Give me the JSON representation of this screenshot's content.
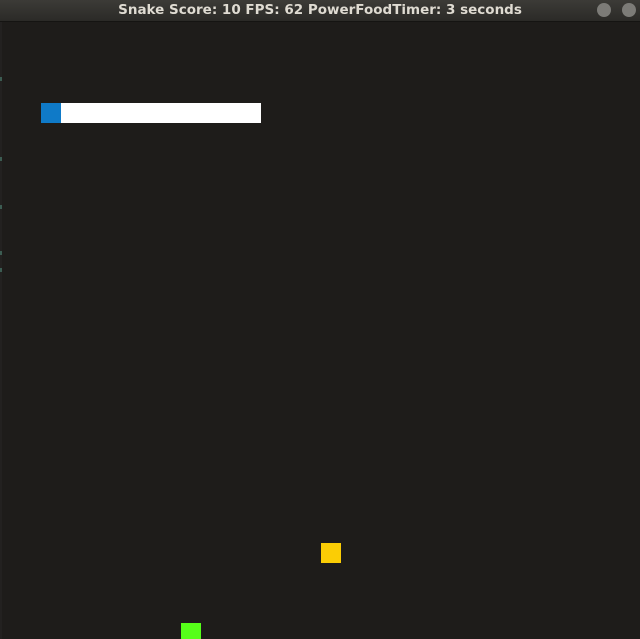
{
  "window": {
    "title": "Snake Score: 10 FPS: 62 PowerFoodTimer: 3 seconds"
  },
  "game": {
    "colors": {
      "background": "#1e1c1a",
      "snake_head": "#0f7ac8",
      "snake_body": "#ffffff",
      "food": "#fbcd05",
      "power_food": "#56ff19"
    }
  }
}
